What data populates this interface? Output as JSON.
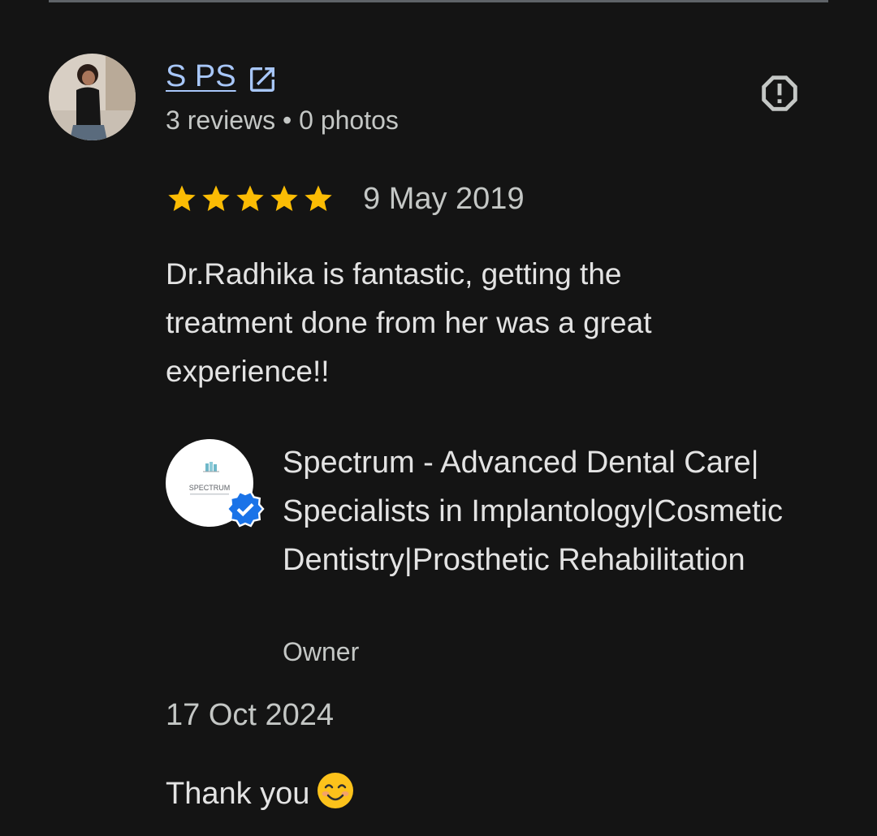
{
  "reviewer": {
    "name": "S PS",
    "meta": "3 reviews • 0 photos"
  },
  "review": {
    "rating": 5,
    "rating_max": 5,
    "date": "9 May 2019",
    "text": "Dr.Radhika is fantastic, getting the treatment done from her was a great experience!!"
  },
  "owner_reply": {
    "logo_text": "SPECTRUM",
    "owner_name": "Spectrum - Advanced Dental Care| Specialists in Implantology|Cosmetic Dentistry|Prosthetic Rehabilitation",
    "role": "Owner",
    "date": "17 Oct 2024",
    "text": "Thank you"
  },
  "icons": {
    "open_link": "open-in-new-icon",
    "report": "report-icon",
    "star": "star-icon",
    "verified": "verified-badge-icon",
    "emoji": "smiling-face-emoji"
  },
  "colors": {
    "background": "#141414",
    "link": "#a8c7fa",
    "star": "#fbbc04",
    "verified": "#1a73e8",
    "text_primary": "#e3e3e3",
    "text_secondary": "#c4c7c5"
  }
}
